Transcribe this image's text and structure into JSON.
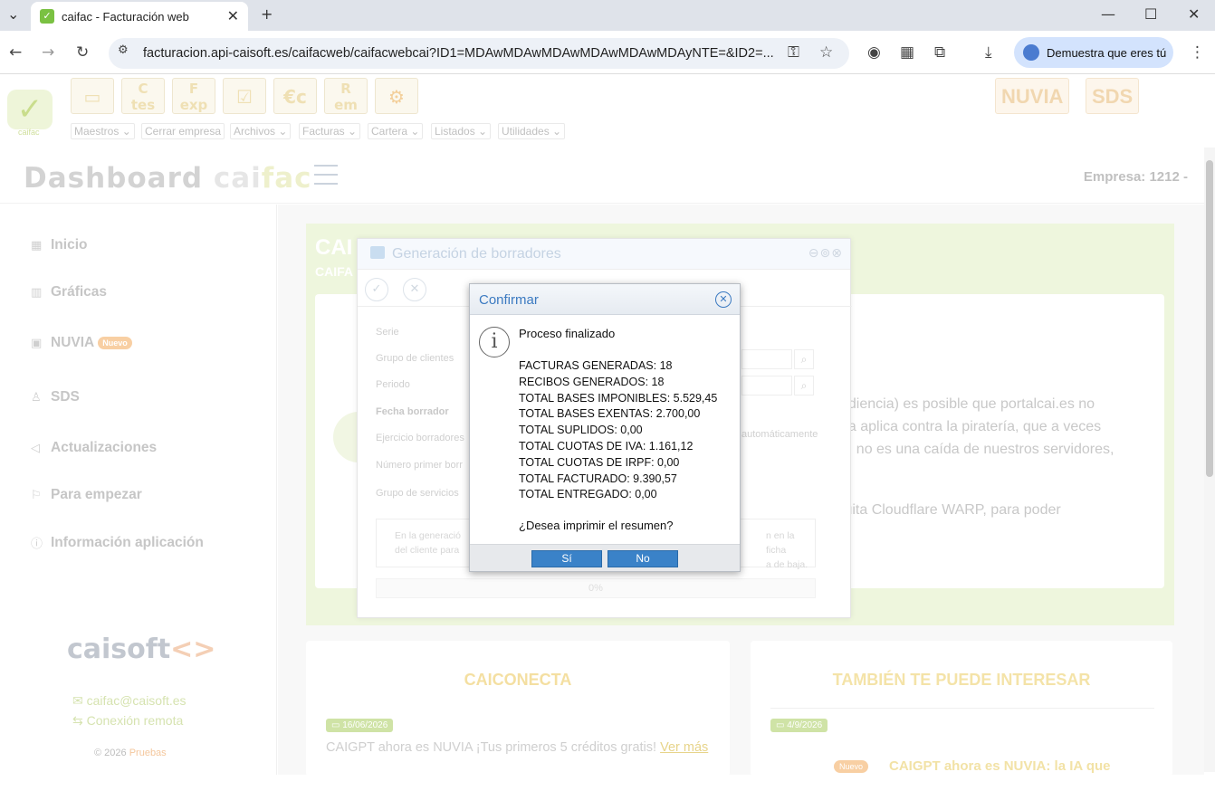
{
  "browser": {
    "tab_title": "caifac - Facturación web",
    "url": "facturacion.api-caisoft.es/caifacweb/caifacwebcai?ID1=MDAwMDAwMDAwMDAwMDAwMDAyNTE=&ID2=...",
    "profile_button": "Demuestra que eres tú"
  },
  "app_header": {
    "toolbar_buttons": [
      "C\ntes",
      "F\nexp",
      "€c",
      "R\nem"
    ],
    "menu": [
      "Maestros",
      "Cerrar empresa",
      "Archivos",
      "Facturas",
      "Cartera",
      "Listados",
      "Utilidades"
    ],
    "logo_sub": "caifac",
    "right_buttons": [
      "NUVIA",
      "SDS"
    ]
  },
  "dashboard": {
    "title_part1": "Dashboard ",
    "title_part2": "cai",
    "title_part3": "fac",
    "empresa": "Empresa: 1212 -"
  },
  "sidebar": {
    "items": [
      {
        "icon": "grid-icon",
        "label": "Inicio"
      },
      {
        "icon": "bar-chart-icon",
        "label": "Gráficas"
      },
      {
        "icon": "robot-icon",
        "label": "NUVIA",
        "badge": "Nuevo"
      },
      {
        "icon": "user-icon",
        "label": "SDS"
      },
      {
        "icon": "megaphone-icon",
        "label": "Actualizaciones"
      },
      {
        "icon": "flag-icon",
        "label": "Para empezar"
      },
      {
        "icon": "info-icon",
        "label": "Información aplicación"
      }
    ],
    "brand": "caisoft",
    "email": "caifac@caisoft.es",
    "remote": "Conexión remota",
    "copyright": "© 2026 ",
    "copyright_link": "Pruebas"
  },
  "banner": {
    "title": "CAI",
    "subtitle": "CAIFA",
    "lines": [
      "udiencia) es posible que portalcai.es no",
      "ga aplica contra la piratería, que a veces",
      "n, no es una caída de nuestros servidores,",
      "tuita Cloudflare WARP, para poder"
    ]
  },
  "cards": {
    "left_title": "CAICONECTA",
    "left_date": "16/06/2026",
    "left_text": "CAIGPT ahora es NUVIA ¡Tus primeros 5 créditos gratis! ",
    "left_link": "Ver más",
    "right_title": "TAMBIÉN TE PUEDE INTERESAR",
    "right_date": "4/9/2026",
    "right_badge": "Nuevo",
    "right_text": "CAIGPT ahora es NUVIA: la IA que"
  },
  "gen_dialog": {
    "title": "Generación de borradores",
    "fields": [
      "Serie",
      "Grupo de clientes",
      "Periodo",
      "Fecha borrador",
      "Ejercicio borradores",
      "Número primer borr",
      "Grupo de servicios"
    ],
    "auto": "automáticamente",
    "info_left": [
      "En la generació",
      "del cliente para"
    ],
    "info_right": [
      "n en la ficha",
      "a de baja."
    ],
    "progress": "0%"
  },
  "confirm": {
    "title": "Confirmar",
    "heading": "Proceso finalizado",
    "lines": [
      "FACTURAS GENERADAS: 18",
      "RECIBOS GENERADOS: 18",
      "TOTAL BASES IMPONIBLES: 5.529,45",
      "TOTAL BASES EXENTAS: 2.700,00",
      "TOTAL SUPLIDOS: 0,00",
      "TOTAL CUOTAS DE IVA: 1.161,12",
      "TOTAL CUOTAS DE IRPF: 0,00",
      "TOTAL FACTURADO: 9.390,57",
      "TOTAL ENTREGADO: 0,00"
    ],
    "question": "¿Desea imprimir el resumen?",
    "yes": "Sí",
    "no": "No"
  }
}
